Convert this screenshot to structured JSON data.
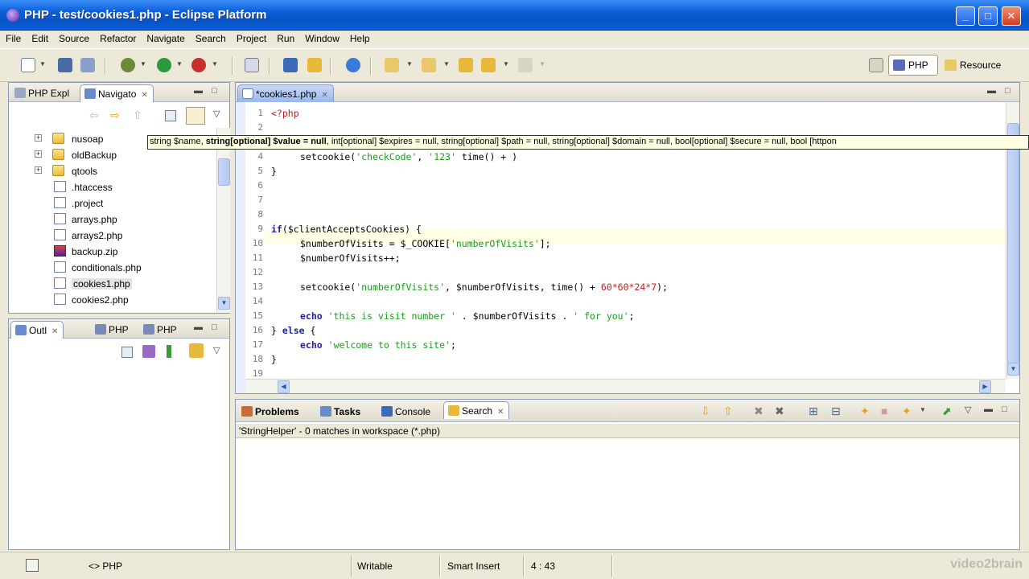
{
  "window": {
    "title": "PHP - test/cookies1.php - Eclipse Platform"
  },
  "menu": [
    "File",
    "Edit",
    "Source",
    "Refactor",
    "Navigate",
    "Search",
    "Project",
    "Run",
    "Window",
    "Help"
  ],
  "perspectives": {
    "php": "PHP",
    "resource": "Resource"
  },
  "navigator": {
    "tabs": [
      "PHP Expl",
      "Navigato"
    ],
    "items": [
      {
        "label": "nusoap",
        "type": "folder",
        "expandable": true
      },
      {
        "label": "oldBackup",
        "type": "folder",
        "expandable": true
      },
      {
        "label": "qtools",
        "type": "folder",
        "expandable": true
      },
      {
        "label": ".htaccess",
        "type": "file"
      },
      {
        "label": ".project",
        "type": "file"
      },
      {
        "label": "arrays.php",
        "type": "file"
      },
      {
        "label": "arrays2.php",
        "type": "file"
      },
      {
        "label": "backup.zip",
        "type": "zip"
      },
      {
        "label": "conditionals.php",
        "type": "file"
      },
      {
        "label": "cookies1.php",
        "type": "file",
        "selected": true
      },
      {
        "label": "cookies2.php",
        "type": "file"
      }
    ]
  },
  "outline": {
    "tabs": [
      "Outl",
      "PHP",
      "PHP"
    ]
  },
  "editor": {
    "tab": "*cookies1.php",
    "line_numbers": [
      "1",
      "2",
      "3",
      "4",
      "5",
      "6",
      "7",
      "8",
      "9",
      "10",
      "11",
      "12",
      "13",
      "14",
      "15",
      "16",
      "17",
      "18",
      "19"
    ],
    "tooltip": {
      "p1": "string $name, ",
      "p2": "string[optional] $value = null",
      "p3": ", int[optional] $expires = null, string[optional] $path = null, string[optional] $domain = null, bool[optional] $secure = null, bool [httpon"
    },
    "code": {
      "l1": "<?php",
      "l4a": "setcookie(",
      "l4b": "'checkCode'",
      "l4c": ", ",
      "l4d": "'123'",
      "l4e": " time() + )",
      "l5": "}",
      "l9a": "if",
      "l9b": "($clientAcceptsCookies) {",
      "l10a": "$numberOfVisits = $_COOKIE[",
      "l10b": "'numberOfVisits'",
      "l10c": "];",
      "l11": "$numberOfVisits++;",
      "l13a": "setcookie(",
      "l13b": "'numberOfVisits'",
      "l13c": ", $numberOfVisits, time() + ",
      "l13d": "60*60*24*7",
      "l13e": ");",
      "l15a": "echo",
      "l15b": " 'this is visit number '",
      "l15c": " . $numberOfVisits . ",
      "l15d": "' for you'",
      "l15e": ";",
      "l16a": "} ",
      "l16b": "else",
      "l16c": " {",
      "l17a": "echo",
      "l17b": " 'welcome to this site'",
      "l17c": ";",
      "l18": "}"
    }
  },
  "bottom": {
    "tabs": [
      "Problems",
      "Tasks",
      "Console",
      "Search"
    ],
    "search_result": "'StringHelper' - 0 matches in workspace (*.php)"
  },
  "status": {
    "lang": "<> PHP",
    "writable": "Writable",
    "insert": "Smart Insert",
    "position": "4 : 43",
    "watermark": "video2brain"
  },
  "colors": {
    "titlebar": "#0a5fd8",
    "keyword": "#1e1eaa",
    "string": "#18a018",
    "number": "#c02020"
  }
}
